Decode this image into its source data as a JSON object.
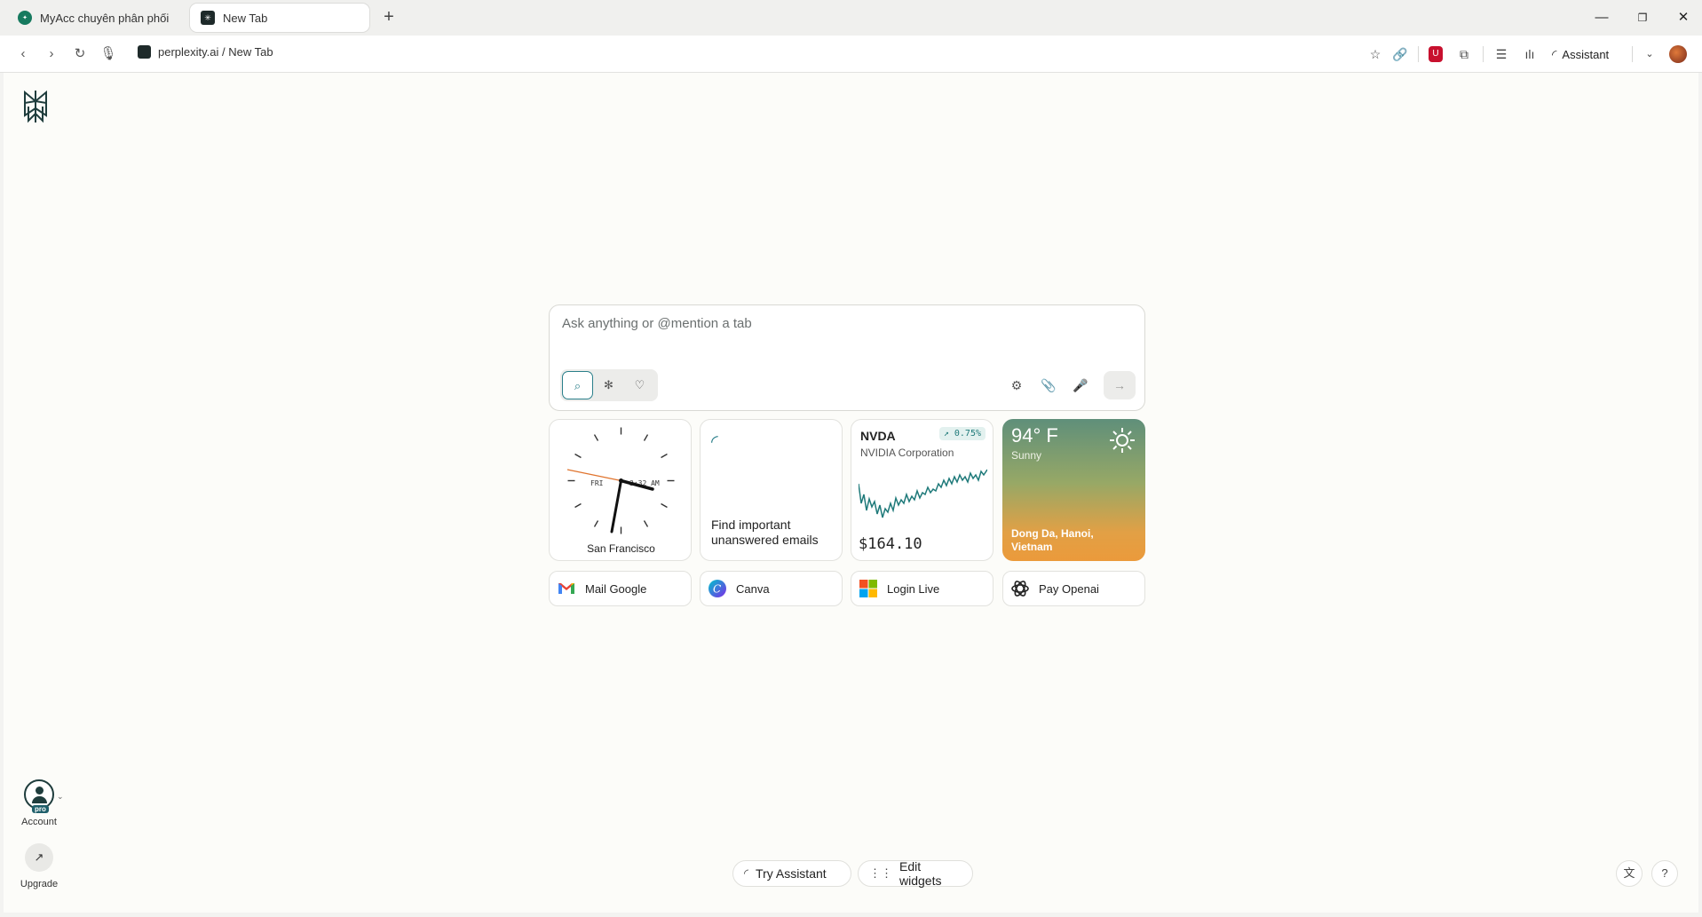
{
  "tabs": [
    {
      "label": "MyAcc chuyên phân phối các",
      "favicon": "myacc-favicon"
    },
    {
      "label": "New Tab",
      "favicon": "perplexity-favicon"
    }
  ],
  "address": {
    "url": "perplexity.ai / New Tab"
  },
  "toolbar": {
    "assistant_label": "Assistant"
  },
  "search": {
    "placeholder": "Ask anything or @mention a tab"
  },
  "widgets": {
    "clock": {
      "day": "FRI",
      "time": "3:32 AM",
      "city": "San Francisco"
    },
    "email": {
      "text": "Find important unanswered emails"
    },
    "stock": {
      "ticker": "NVDA",
      "change": "↗ 0.75%",
      "company": "NVIDIA Corporation",
      "price": "$164.10"
    },
    "weather": {
      "temp": "94° F",
      "condition": "Sunny",
      "location": "Dong Da, Hanoi, Vietnam"
    }
  },
  "shortcuts": [
    {
      "label": "Mail Google"
    },
    {
      "label": "Canva"
    },
    {
      "label": "Login Live"
    },
    {
      "label": "Pay Openai"
    }
  ],
  "sidebar": {
    "account_label": "Account",
    "pro_badge": "pro",
    "upgrade_label": "Upgrade"
  },
  "bottom": {
    "try_assistant": "Try Assistant",
    "edit_widgets": "Edit widgets"
  },
  "colors": {
    "accent": "#2a7f8a",
    "background": "#fcfcf9",
    "ublock": "#c8102e"
  }
}
